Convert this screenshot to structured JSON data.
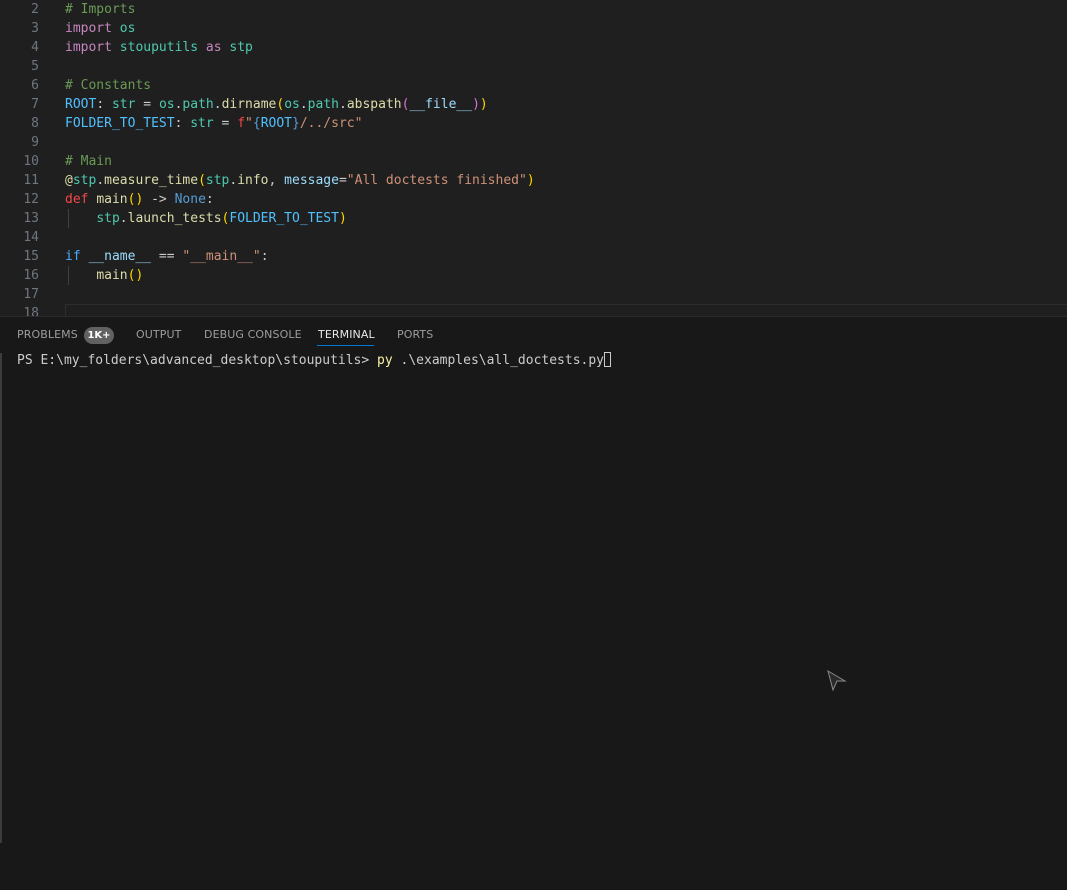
{
  "editor": {
    "lines": [
      {
        "num": "2",
        "tokens": [
          {
            "t": "# Imports",
            "c": "t-comment"
          }
        ]
      },
      {
        "num": "3",
        "tokens": [
          {
            "t": "import",
            "c": "t-kw"
          },
          {
            "t": " ",
            "c": "t-plain"
          },
          {
            "t": "os",
            "c": "t-mod"
          }
        ]
      },
      {
        "num": "4",
        "tokens": [
          {
            "t": "import",
            "c": "t-kw"
          },
          {
            "t": " ",
            "c": "t-plain"
          },
          {
            "t": "stouputils",
            "c": "t-mod"
          },
          {
            "t": " ",
            "c": "t-plain"
          },
          {
            "t": "as",
            "c": "t-kw"
          },
          {
            "t": " ",
            "c": "t-plain"
          },
          {
            "t": "stp",
            "c": "t-mod"
          }
        ]
      },
      {
        "num": "5",
        "tokens": []
      },
      {
        "num": "6",
        "tokens": [
          {
            "t": "# Constants",
            "c": "t-comment"
          }
        ]
      },
      {
        "num": "7",
        "tokens": [
          {
            "t": "ROOT",
            "c": "t-var"
          },
          {
            "t": ": ",
            "c": "t-plain"
          },
          {
            "t": "str",
            "c": "t-type"
          },
          {
            "t": " = ",
            "c": "t-plain"
          },
          {
            "t": "os",
            "c": "t-mod"
          },
          {
            "t": ".",
            "c": "t-plain"
          },
          {
            "t": "path",
            "c": "t-mod"
          },
          {
            "t": ".",
            "c": "t-plain"
          },
          {
            "t": "dirname",
            "c": "t-fn"
          },
          {
            "t": "(",
            "c": "t-paren1"
          },
          {
            "t": "os",
            "c": "t-mod"
          },
          {
            "t": ".",
            "c": "t-plain"
          },
          {
            "t": "path",
            "c": "t-mod"
          },
          {
            "t": ".",
            "c": "t-plain"
          },
          {
            "t": "abspath",
            "c": "t-fn"
          },
          {
            "t": "(",
            "c": "t-paren2"
          },
          {
            "t": "__file__",
            "c": "t-dunder"
          },
          {
            "t": ")",
            "c": "t-paren2"
          },
          {
            "t": ")",
            "c": "t-paren1"
          }
        ]
      },
      {
        "num": "8",
        "tokens": [
          {
            "t": "FOLDER_TO_TEST",
            "c": "t-var"
          },
          {
            "t": ": ",
            "c": "t-plain"
          },
          {
            "t": "str",
            "c": "t-type"
          },
          {
            "t": " = ",
            "c": "t-plain"
          },
          {
            "t": "f",
            "c": "t-def"
          },
          {
            "t": "\"",
            "c": "t-str"
          },
          {
            "t": "{",
            "c": "t-none"
          },
          {
            "t": "ROOT",
            "c": "t-var"
          },
          {
            "t": "}",
            "c": "t-none"
          },
          {
            "t": "/../src\"",
            "c": "t-str"
          }
        ]
      },
      {
        "num": "9",
        "tokens": []
      },
      {
        "num": "10",
        "tokens": [
          {
            "t": "# Main",
            "c": "t-comment"
          }
        ]
      },
      {
        "num": "11",
        "tokens": [
          {
            "t": "@",
            "c": "t-fn"
          },
          {
            "t": "stp",
            "c": "t-mod"
          },
          {
            "t": ".",
            "c": "t-plain"
          },
          {
            "t": "measure_time",
            "c": "t-fn"
          },
          {
            "t": "(",
            "c": "t-paren1"
          },
          {
            "t": "stp",
            "c": "t-mod"
          },
          {
            "t": ".",
            "c": "t-plain"
          },
          {
            "t": "info",
            "c": "t-fn"
          },
          {
            "t": ", ",
            "c": "t-plain"
          },
          {
            "t": "message",
            "c": "t-prop"
          },
          {
            "t": "=",
            "c": "t-plain"
          },
          {
            "t": "\"All doctests finished\"",
            "c": "t-str"
          },
          {
            "t": ")",
            "c": "t-paren1"
          }
        ]
      },
      {
        "num": "12",
        "tokens": [
          {
            "t": "def",
            "c": "t-def"
          },
          {
            "t": " ",
            "c": "t-plain"
          },
          {
            "t": "main",
            "c": "t-fn"
          },
          {
            "t": "()",
            "c": "t-paren1"
          },
          {
            "t": " -> ",
            "c": "t-plain"
          },
          {
            "t": "None",
            "c": "t-none"
          },
          {
            "t": ":",
            "c": "t-plain"
          }
        ]
      },
      {
        "num": "13",
        "tokens": [
          {
            "t": "    ",
            "c": "t-plain"
          },
          {
            "t": "stp",
            "c": "t-mod"
          },
          {
            "t": ".",
            "c": "t-plain"
          },
          {
            "t": "launch_tests",
            "c": "t-fn"
          },
          {
            "t": "(",
            "c": "t-paren1"
          },
          {
            "t": "FOLDER_TO_TEST",
            "c": "t-var"
          },
          {
            "t": ")",
            "c": "t-paren1"
          }
        ]
      },
      {
        "num": "14",
        "tokens": []
      },
      {
        "num": "15",
        "tokens": [
          {
            "t": "if",
            "c": "t-if"
          },
          {
            "t": " ",
            "c": "t-plain"
          },
          {
            "t": "__name__",
            "c": "t-dunder"
          },
          {
            "t": " == ",
            "c": "t-plain"
          },
          {
            "t": "\"__main__\"",
            "c": "t-str"
          },
          {
            "t": ":",
            "c": "t-plain"
          }
        ]
      },
      {
        "num": "16",
        "tokens": [
          {
            "t": "    ",
            "c": "t-plain"
          },
          {
            "t": "main",
            "c": "t-fn"
          },
          {
            "t": "()",
            "c": "t-paren1"
          }
        ]
      },
      {
        "num": "17",
        "tokens": []
      },
      {
        "num": "18",
        "tokens": []
      }
    ]
  },
  "panel": {
    "tabs": {
      "problems": "PROBLEMS",
      "problems_badge": "1K+",
      "output": "OUTPUT",
      "debug_console": "DEBUG CONSOLE",
      "terminal": "TERMINAL",
      "ports": "PORTS"
    },
    "active_tab": "TERMINAL",
    "terminal": {
      "prompt": "PS E:\\my_folders\\advanced_desktop\\stouputils> ",
      "command": "py",
      "args": " .\\examples\\all_doctests.py"
    }
  }
}
